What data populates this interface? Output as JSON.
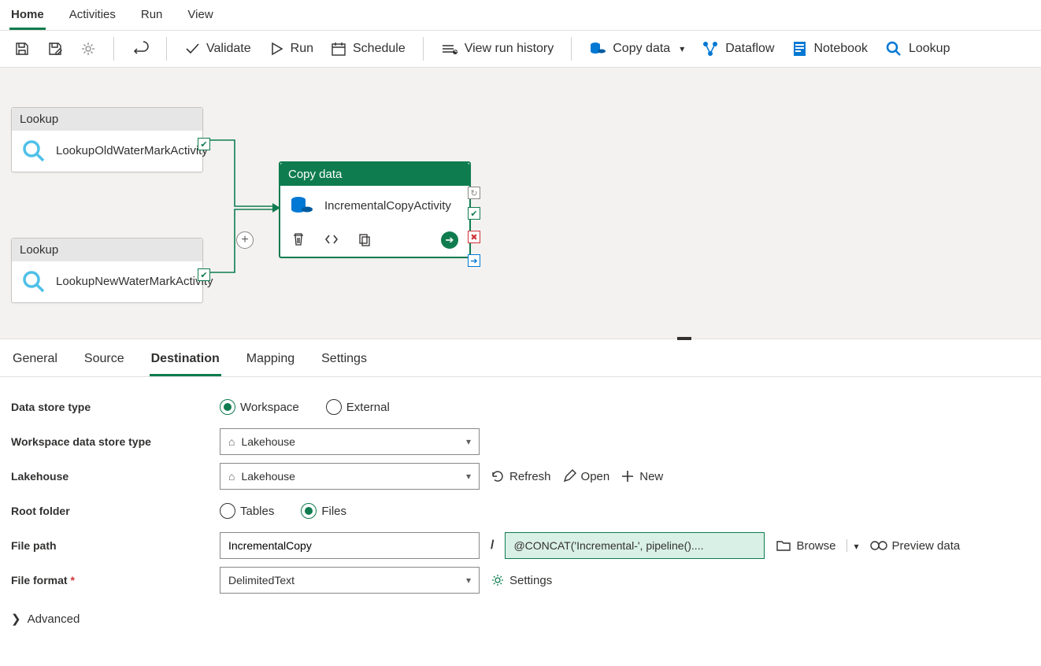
{
  "nav": {
    "items": [
      "Home",
      "Activities",
      "Run",
      "View"
    ],
    "active": 0
  },
  "toolbar": {
    "validate": "Validate",
    "run": "Run",
    "schedule": "Schedule",
    "history": "View run history",
    "copydata": "Copy data",
    "dataflow": "Dataflow",
    "notebook": "Notebook",
    "lookup": "Lookup"
  },
  "canvas": {
    "lookup_label": "Lookup",
    "lookup1_name": "LookupOldWaterMarkActivity",
    "lookup2_name": "LookupNewWaterMarkActivity",
    "copy_label": "Copy data",
    "copy_name": "IncrementalCopyActivity"
  },
  "proptabs": {
    "items": [
      "General",
      "Source",
      "Destination",
      "Mapping",
      "Settings"
    ],
    "active": 2
  },
  "form": {
    "datastore_type_label": "Data store type",
    "datastore_workspace": "Workspace",
    "datastore_external": "External",
    "ws_type_label": "Workspace data store type",
    "ws_type_value": "Lakehouse",
    "lakehouse_label": "Lakehouse",
    "lakehouse_value": "Lakehouse",
    "refresh": "Refresh",
    "open": "Open",
    "new": "New",
    "rootfolder_label": "Root folder",
    "root_tables": "Tables",
    "root_files": "Files",
    "filepath_label": "File path",
    "filepath_folder": "IncrementalCopy",
    "filepath_expr": "@CONCAT('Incremental-', pipeline()....",
    "browse": "Browse",
    "preview": "Preview data",
    "fileformat_label": "File format",
    "fileformat_value": "DelimitedText",
    "settings": "Settings",
    "advanced": "Advanced"
  }
}
